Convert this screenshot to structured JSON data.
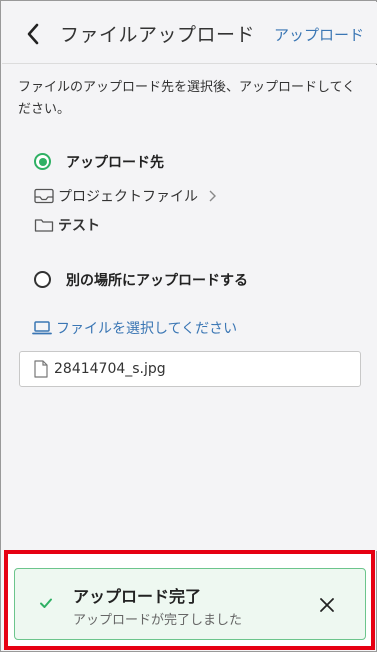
{
  "header": {
    "title": "ファイルアップロード",
    "action_label": "アップロード"
  },
  "instruction": "ファイルのアップロード先を選択後、アップロードしてください。",
  "destination": {
    "option1_label": "アップロード先",
    "option1_checked": true,
    "path": [
      {
        "label": "プロジェクトファイル",
        "icon": "inbox-icon"
      },
      {
        "label": "テスト",
        "icon": "folder-icon"
      }
    ],
    "option2_label": "別の場所にアップロードする",
    "option2_checked": false
  },
  "file_select": {
    "link_label": "ファイルを選択してください",
    "file_name": "28414704_s.jpg"
  },
  "toast": {
    "title": "アップロード完了",
    "message": "アップロードが完了しました"
  },
  "colors": {
    "accent": "#3a76b4",
    "success": "#2fb064",
    "highlight_border": "#e60012"
  }
}
